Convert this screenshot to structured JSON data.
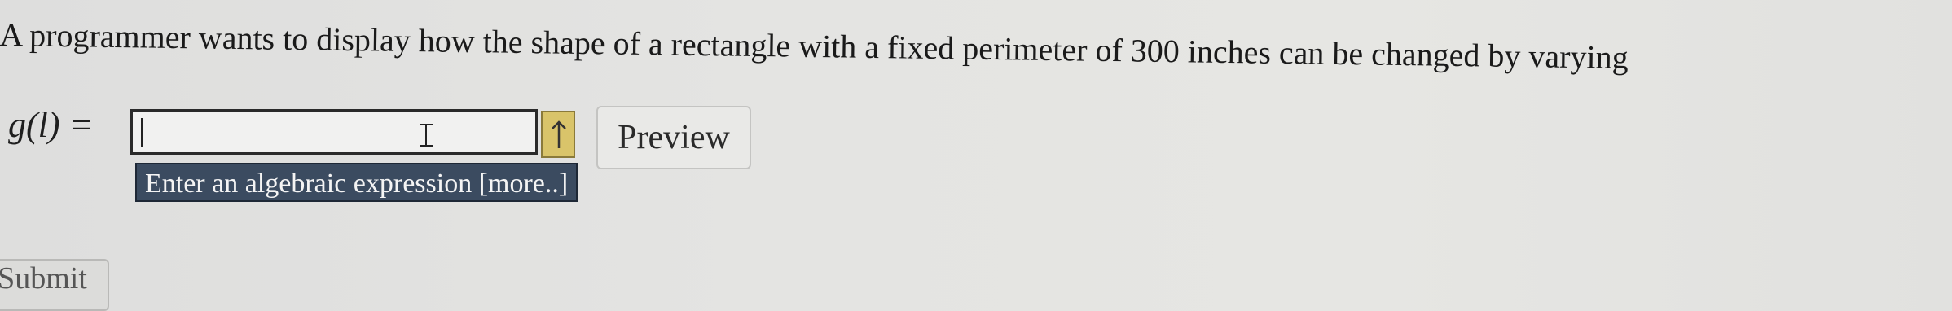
{
  "question": {
    "text": "A programmer wants to display how the shape of a rectangle with a fixed perimeter of 300 inches can be changed by varying"
  },
  "answer": {
    "label": "g(l) =",
    "value": "",
    "tooltip": "Enter an algebraic expression [more..]"
  },
  "buttons": {
    "preview_label": "Preview",
    "submit_label": "Submit"
  },
  "icons": {
    "ibeam": "text-cursor-icon",
    "hint": "up-arrow-icon"
  },
  "colors": {
    "tooltip_bg": "#3b4b60",
    "hint_tab": "#d9c46a"
  }
}
